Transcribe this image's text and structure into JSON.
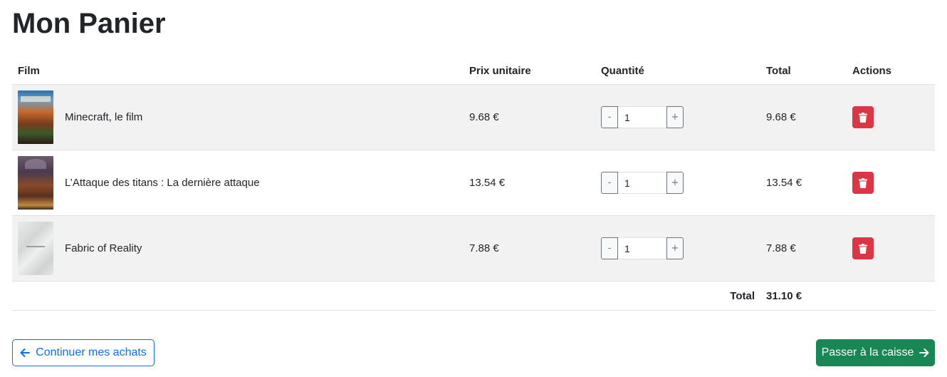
{
  "page_title": "Mon Panier",
  "table": {
    "headers": {
      "film": "Film",
      "unit_price": "Prix unitaire",
      "quantity": "Quantité",
      "total": "Total",
      "actions": "Actions"
    },
    "rows": [
      {
        "title": "Minecraft, le film",
        "unit_price": "9.68 €",
        "qty_minus": "-",
        "quantity": "1",
        "qty_plus": "+",
        "total": "9.68 €",
        "poster_icon": "movie-poster-image"
      },
      {
        "title": "L’Attaque des titans : La dernière attaque",
        "unit_price": "13.54 €",
        "qty_minus": "-",
        "quantity": "1",
        "qty_plus": "+",
        "total": "13.54 €",
        "poster_icon": "movie-poster-image"
      },
      {
        "title": "Fabric of Reality",
        "unit_price": "7.88 €",
        "qty_minus": "-",
        "quantity": "1",
        "qty_plus": "+",
        "total": "7.88 €",
        "poster_icon": "movie-poster-image"
      }
    ],
    "footer": {
      "label": "Total",
      "value": "31.10 €"
    }
  },
  "actions": {
    "continue_label": "Continuer mes achats",
    "continue_icon": "arrow-left-icon",
    "checkout_label": "Passer à la caisse",
    "checkout_icon": "arrow-right-icon",
    "delete_icon": "trash-icon"
  },
  "colors": {
    "danger": "#dc3545",
    "primary": "#0d6efd",
    "success": "#198754",
    "stripe": "#f2f2f2"
  }
}
